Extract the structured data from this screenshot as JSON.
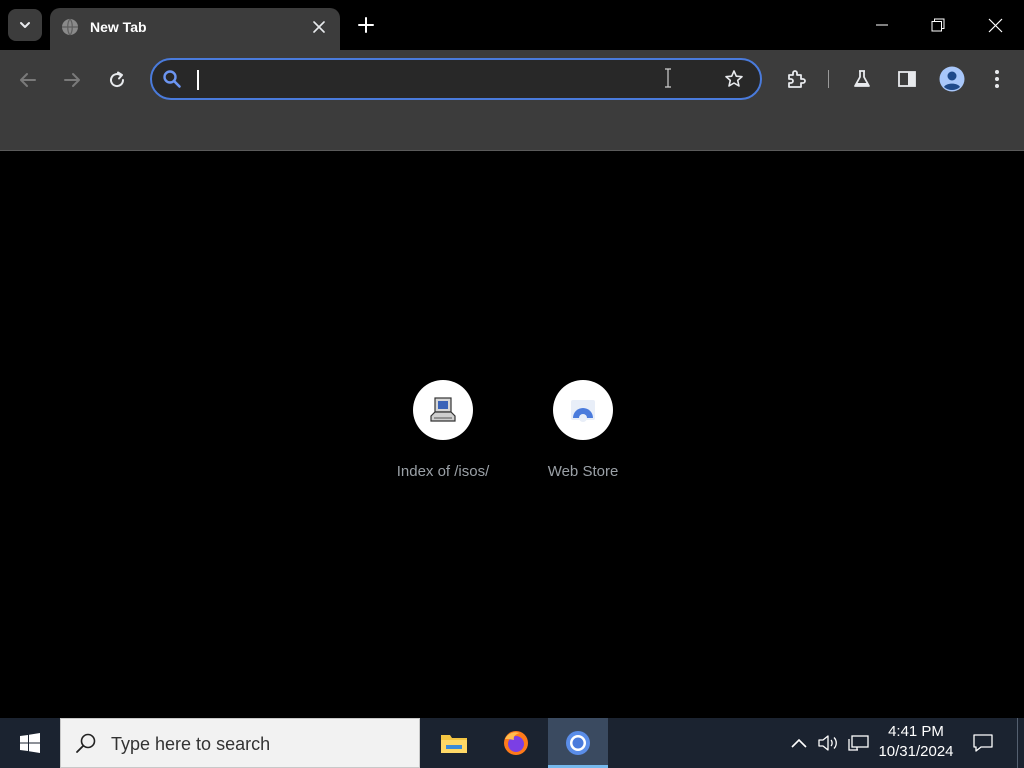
{
  "browser": {
    "tab": {
      "title": "New Tab"
    },
    "omnibox": {
      "value": "",
      "placeholder": ""
    }
  },
  "shortcuts": [
    {
      "label": "Index of /isos/",
      "icon": "computer-icon"
    },
    {
      "label": "Web Store",
      "icon": "web-store-icon"
    }
  ],
  "taskbar": {
    "search_placeholder": "Type here to search",
    "apps": [
      "file-explorer-icon",
      "firefox-icon",
      "chrome-icon"
    ],
    "time": "4:41 PM",
    "date": "10/31/2024"
  },
  "colors": {
    "accent": "#4a7bdc",
    "toolbar": "#3c3c3c",
    "page": "#000000",
    "taskbar": "#1b2330"
  }
}
